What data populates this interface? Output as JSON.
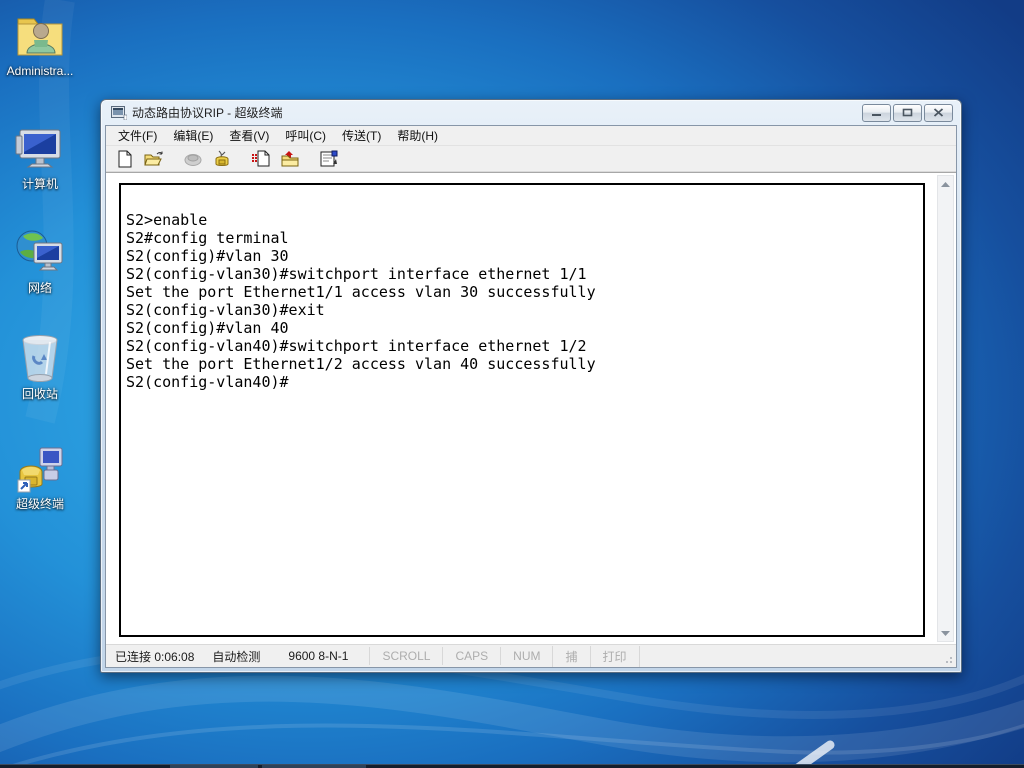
{
  "desktop": {
    "icons": [
      {
        "name": "administrator-folder",
        "label": "Administra..."
      },
      {
        "name": "computer",
        "label": "计算机"
      },
      {
        "name": "network",
        "label": "网络"
      },
      {
        "name": "recycle-bin",
        "label": "回收站"
      },
      {
        "name": "hyperterminal-shortcut",
        "label": "超级终端"
      }
    ]
  },
  "window": {
    "title": "动态路由协议RIP - 超级终端",
    "menu": [
      "文件(F)",
      "编辑(E)",
      "查看(V)",
      "呼叫(C)",
      "传送(T)",
      "帮助(H)"
    ],
    "toolbar_icons": [
      "new-file",
      "open-file",
      "call",
      "hangup",
      "send-file",
      "receive-file",
      "properties"
    ],
    "terminal": {
      "lines": [
        "S2>enable",
        "S2#config terminal",
        "S2(config)#vlan 30",
        "S2(config-vlan30)#switchport interface ethernet 1/1",
        "Set the port Ethernet1/1 access vlan 30 successfully",
        "S2(config-vlan30)#exit",
        "S2(config)#vlan 40",
        "S2(config-vlan40)#switchport interface ethernet 1/2",
        "Set the port Ethernet1/2 access vlan 40 successfully",
        "S2(config-vlan40)#"
      ]
    },
    "statusbar": {
      "connection": "已连接 0:06:08",
      "emulation": "自动检测",
      "baud": "9600 8-N-1",
      "indicators": [
        "SCROLL",
        "CAPS",
        "NUM",
        "捕",
        "打印"
      ]
    },
    "colors": {
      "terminal_text": "#000000",
      "chrome": "#f0f0f0",
      "frame": "#d3e2f1",
      "wallpaper_center": "#35aee8",
      "wallpaper_edge": "#123c86"
    }
  }
}
